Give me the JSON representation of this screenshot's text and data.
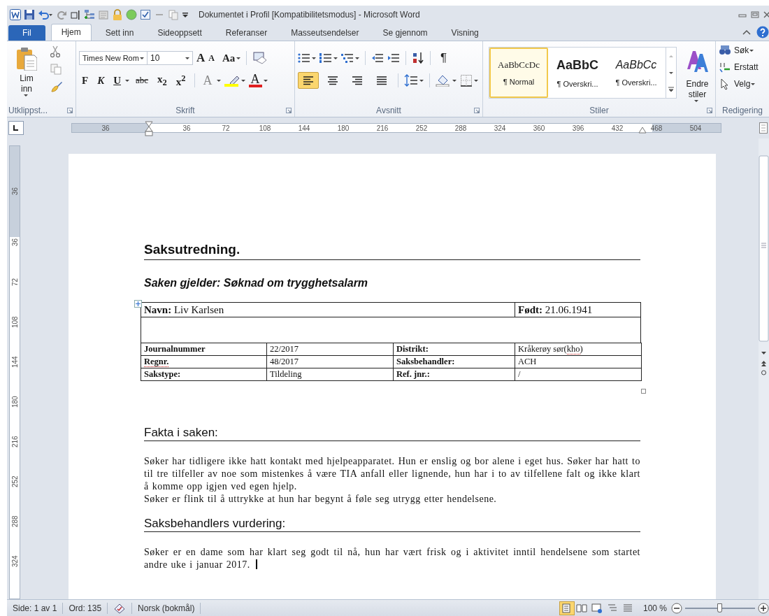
{
  "window": {
    "title": "Dokumentet i Profil [Kompatibilitetsmodus]  -  Microsoft Word"
  },
  "tabs": [
    {
      "label": "Fil",
      "kind": "file",
      "selected": false
    },
    {
      "label": "Hjem",
      "kind": "tab",
      "selected": true
    },
    {
      "label": "Sett inn",
      "kind": "tab",
      "selected": false
    },
    {
      "label": "Sideoppsett",
      "kind": "tab",
      "selected": false
    },
    {
      "label": "Referanser",
      "kind": "tab",
      "selected": false
    },
    {
      "label": "Masseutsendelser",
      "kind": "tab",
      "selected": false
    },
    {
      "label": "Se gjennom",
      "kind": "tab",
      "selected": false
    },
    {
      "label": "Visning",
      "kind": "tab",
      "selected": false
    }
  ],
  "ribbon": {
    "clipboard": {
      "paste": "Lim inn",
      "label": "Utklippst..."
    },
    "font": {
      "name": "Times New Rom",
      "size": "10",
      "label": "Skrift",
      "sizing": [
        {
          "label": "A",
          "kind": "grow"
        },
        {
          "label": "A",
          "kind": "shrink"
        },
        {
          "label": "Aa",
          "kind": "case"
        }
      ],
      "styles": [
        {
          "label": "F",
          "kind": "bold"
        },
        {
          "label": "K",
          "kind": "italic"
        },
        {
          "label": "U",
          "kind": "underline"
        },
        {
          "label": "abc",
          "kind": "strike"
        },
        {
          "label": "x$_{2}$",
          "kind": "sub"
        },
        {
          "label": "x$^{2}$",
          "kind": "sup"
        }
      ],
      "effects": "A",
      "font_color_button": "A"
    },
    "paragraph": {
      "label": "Avsnitt",
      "pilcrow": "¶",
      "alignments": [
        {
          "selected": true
        },
        {
          "selected": false
        },
        {
          "selected": false
        },
        {
          "selected": false
        }
      ]
    },
    "styles": {
      "label": "Stiler",
      "change": "Endre stiler",
      "items": [
        {
          "preview": "AaBbCcDc",
          "name": "¶ Normal",
          "kind": "normal",
          "selected": true
        },
        {
          "preview": "AaBbC",
          "name": "¶ Overskri...",
          "kind": "heading1",
          "selected": false
        },
        {
          "preview": "AaBbCc",
          "name": "¶ Overskri...",
          "kind": "heading2",
          "selected": false
        }
      ]
    },
    "editing": {
      "label": "Redigering",
      "items": [
        "Søk",
        "Erstatt",
        "Velg"
      ]
    }
  },
  "ruler": {
    "marks": [
      "36",
      "36",
      "72",
      "108",
      "144",
      "180",
      "216",
      "252",
      "288",
      "324",
      "360",
      "396",
      "432",
      "468",
      "504"
    ]
  },
  "vertical_ruler": {
    "marks": [
      "36",
      "36",
      "72",
      "108",
      "144",
      "180",
      "216",
      "252",
      "288",
      "324"
    ]
  },
  "document": {
    "title": "Saksutredning.",
    "subject": "Saken gjelder:  Søknad om trygghetsalarm",
    "person_row": [
      "**Navn:** Liv Karlsen",
      "**Født:**  21.06.1941"
    ],
    "case_rows": [
      [
        {
          "bold": true,
          "parts": [
            {
              "text": "Journalnummer",
              "misspelled": false
            }
          ]
        },
        {
          "bold": false,
          "parts": [
            {
              "text": "22/2017",
              "misspelled": false
            }
          ]
        },
        {
          "bold": true,
          "parts": [
            {
              "text": "Distrikt:",
              "misspelled": false
            }
          ]
        },
        {
          "bold": false,
          "parts": [
            {
              "text": "Kråkerøy sør(",
              "misspelled": false
            },
            {
              "text": "kho",
              "misspelled": true
            },
            {
              "text": ")",
              "misspelled": false
            }
          ]
        }
      ],
      [
        {
          "bold": true,
          "parts": [
            {
              "text": "Regnr.",
              "misspelled": true
            }
          ]
        },
        {
          "bold": false,
          "parts": [
            {
              "text": "48/2017",
              "misspelled": false
            }
          ]
        },
        {
          "bold": true,
          "parts": [
            {
              "text": "Saksbehandler:",
              "misspelled": false
            }
          ]
        },
        {
          "bold": false,
          "parts": [
            {
              "text": "ACH",
              "misspelled": false
            }
          ]
        }
      ],
      [
        {
          "bold": true,
          "parts": [
            {
              "text": "Sakstype:",
              "misspelled": false
            }
          ]
        },
        {
          "bold": false,
          "parts": [
            {
              "text": "Tildeling",
              "misspelled": false
            }
          ]
        },
        {
          "bold": true,
          "parts": [
            {
              "text": "Ref. jnr.:",
              "misspelled": false
            }
          ]
        },
        {
          "bold": false,
          "parts": [
            {
              "text": "/",
              "misspelled": false
            }
          ]
        }
      ]
    ],
    "sections": [
      {
        "heading": "Fakta i saken:",
        "cursor": false,
        "paragraphs": [
          "Søker har tidligere ikke hatt kontakt med hjelpeapparatet. Hun er enslig og bor alene i eget hus. Søker har hatt to til tre tilfeller av noe som mistenkes å være TIA anfall eller lignende, hun har i to av tilfellene falt og ikke klart å komme opp igjen ved egen hjelp.",
          "Søker er flink til å uttrykke at hun har begynt å føle seg utrygg etter hendelsene."
        ]
      },
      {
        "heading": "Saksbehandlers vurdering:",
        "cursor": true,
        "paragraphs": [
          "Søker er en dame som har klart seg godt til nå, hun har vært frisk og i aktivitet inntil hendelsene som startet andre uke i januar 2017."
        ]
      }
    ]
  },
  "status_bar": {
    "page": "Side: 1 av 1",
    "words": "Ord: 135",
    "language": "Norsk (bokmål)",
    "views": [
      {
        "selected": true
      },
      {
        "selected": false
      },
      {
        "selected": false
      },
      {
        "selected": false
      },
      {
        "selected": false
      }
    ],
    "zoom": "100 %",
    "zoom_slider": {
      "level": 0.5
    }
  }
}
